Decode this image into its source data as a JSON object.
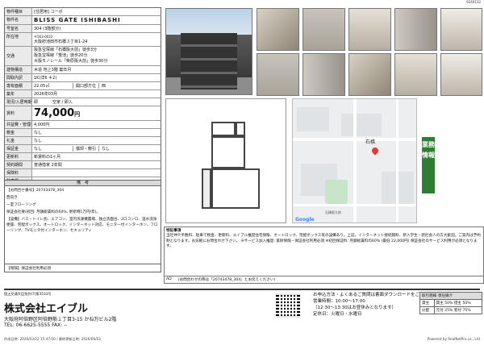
{
  "doc_id": "9240132",
  "property": {
    "type_label": "物件種目",
    "type_value": "[住居用] コーポ",
    "name_label": "物件名",
    "name_value": "BLISS GATE ISHIBASHI",
    "room_label": "号室名",
    "room_value": "304 (3階部分)",
    "location_label": "所在地",
    "postcode": "〒563-0032",
    "address": "大阪府池田市石橋３丁目1-24",
    "traffic_label": "交通",
    "traffic": [
      "阪急宝塚線「石橋阪大前」徒歩3分",
      "阪急宝塚線「蛍池」徒歩20分",
      "大阪モノレール「柴原阪大前」徒歩30分"
    ],
    "structure_label": "建物構造",
    "structure_value": "木造 地上3階 築年月",
    "layout_label": "間取内訳",
    "layout_value": "1K(洋6 キ2)",
    "area_label": "専有面積",
    "area_value": "22.05㎡",
    "aperture_label": "開口部方位",
    "aperture_value": "西",
    "built_label": "築年",
    "built_value": "2026年03月",
    "status_label": "現況/入居時期",
    "status_value": "即",
    "status_options": "空家 / 即入",
    "rent_label": "賃料",
    "rent_value": "74,000",
    "rent_unit": "円",
    "mgmt_label": "共益費・管理費",
    "mgmt_value": "4,000円",
    "deposit_label": "敷金",
    "deposit_value": "なし",
    "key_label": "礼金",
    "key_value": "なし",
    "guarantee_label": "保証金",
    "guarantee_value": "なし",
    "amort_label": "償却・敷引",
    "amort_value": "なし",
    "renew_label": "更新料",
    "renew_value": "新賃料の1ヶ月",
    "contract_label": "契約期間",
    "contract_value": "普通借家 2年間",
    "insurance_label": "保険料",
    "insurance_value": "",
    "parking_label": "駐車場",
    "parking_value": ""
  },
  "remarks": {
    "header": "備　考",
    "lines": [
      "【お問合せ番号】20743478_304",
      "西向き",
      "一室フローリング",
      "保証会社要(初回: 月額総賃料の60%, 更新時1万円/年)。",
      "【設備】バス・トイレ別、エアコン、室内洗濯機置場、独立洗面台、2口コンロ、温水洗浄便座、宅配ボックス、オートロック、インターネット対応、モニター付インターホン、フローリング、TVモニタ付インターホン、セキュリティ"
    ],
    "insurance_line": "【保険】保証会社利用必須"
  },
  "map": {
    "place": "石橋",
    "station": "石橋阪大前",
    "credit": "Google"
  },
  "sidebar_label": "業務情報",
  "notes": {
    "title": "特記事項",
    "text": "当社仲介手数料、駐車で税金、更新料、エイブル推奨住宅保険、オートロック、宅配ボックス等の設備あり。上記、インターネット接続無料、新入学生・新社会人の方大歓迎。ご案内は予約制となります。お気軽にお問合わせ下さい。 ※サービス加入推奨: 家財保険・保証会社利用必須 ※初回保証料: 月額総賃料の60% (最低 22,000円) 保証会社のサービス利用が必須となります。",
    "ad_left": "AD",
    "ad_text": "(お問合わせの際は「20743478_304」とお伝えください)"
  },
  "company": {
    "license": "国土交通大臣免許(7)第3533号",
    "name": "株式会社エイブル",
    "address": "大阪府阿倍野区阿倍野筋１丁目3-15 かね万ビル2階",
    "tel": "TEL: 06-6625-5555 FAX: --"
  },
  "inquiry": {
    "line1": "お申込方法・よくあるご質問は書面ダウンロードをご確認ください",
    "line2": "営業時間：10:00～17:00",
    "line3": "（12:30～13:30はお昼休みとなります）",
    "line4": "定休日：火曜日・水曜日"
  },
  "conditions": {
    "title": "取引態様 専任媒介",
    "rows": [
      [
        "貸主",
        "貸主 50% 借主 50%"
      ],
      [
        "分配",
        "元付 25% 客付 75%"
      ]
    ]
  },
  "footer": {
    "left": "作成日時: 2026/03/22 15:47:00 / 最終更新日時: 2026/06/03",
    "right": "Powered by RealNetPro.co., Ltd"
  }
}
